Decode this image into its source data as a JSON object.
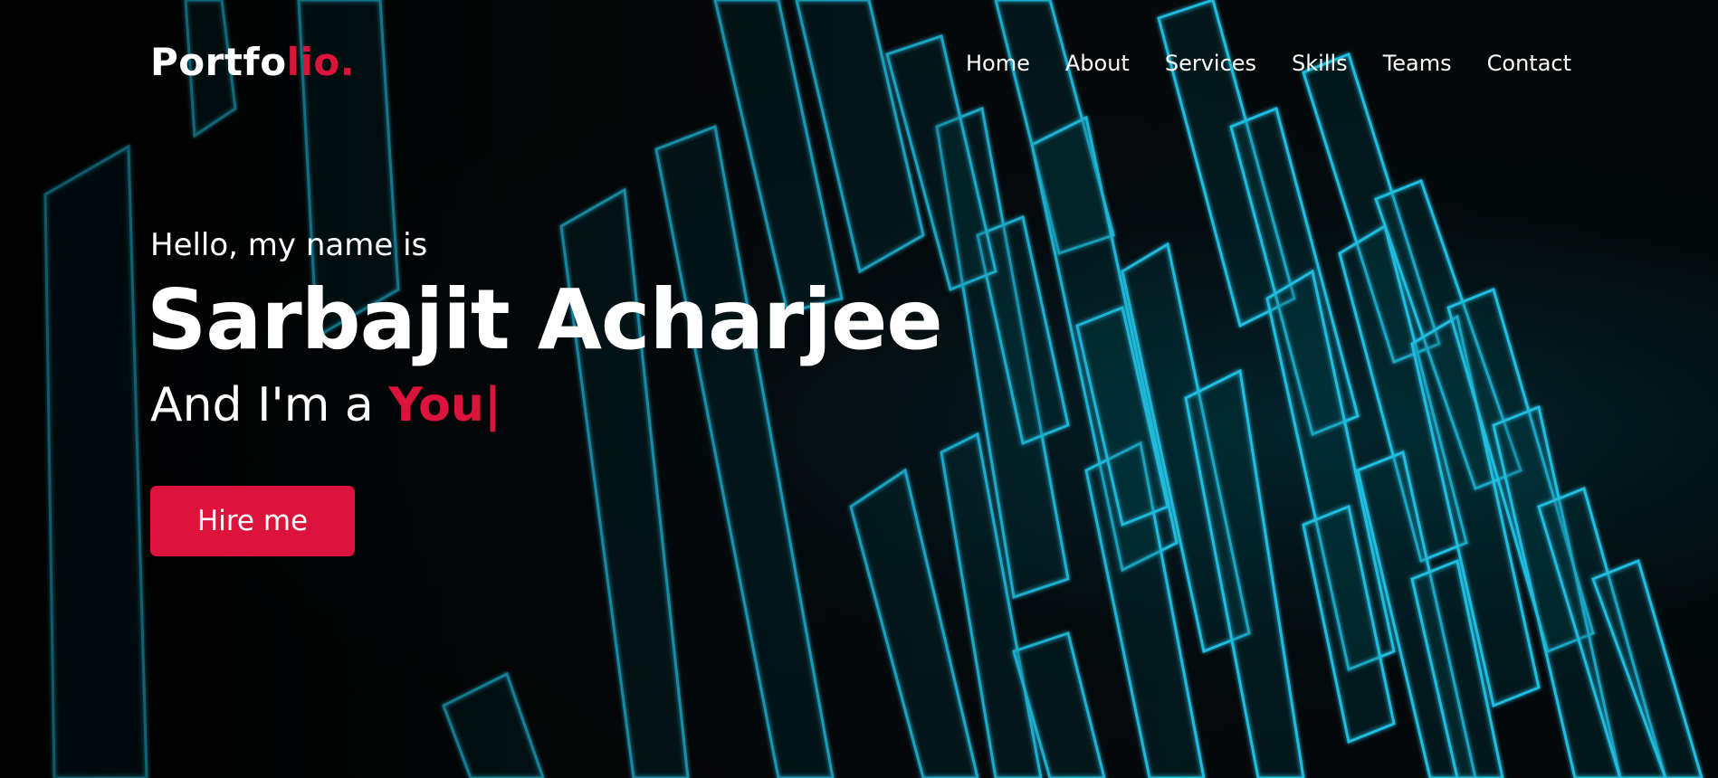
{
  "brand": {
    "logo_main": "Portfo",
    "logo_accent": "lio."
  },
  "nav": {
    "items": [
      {
        "label": "Home"
      },
      {
        "label": "About"
      },
      {
        "label": "Services"
      },
      {
        "label": "Skills"
      },
      {
        "label": "Teams"
      },
      {
        "label": "Contact"
      }
    ]
  },
  "hero": {
    "greeting": "Hello, my name is",
    "name": "Sarbajit Acharjee",
    "role_prefix": "And I'm a ",
    "role_typed": "You",
    "cursor": "|",
    "cta_label": "Hire me"
  },
  "colors": {
    "accent": "#dc143c",
    "text": "#ffffff",
    "background": "#050607",
    "glow": "#21c4e8"
  }
}
